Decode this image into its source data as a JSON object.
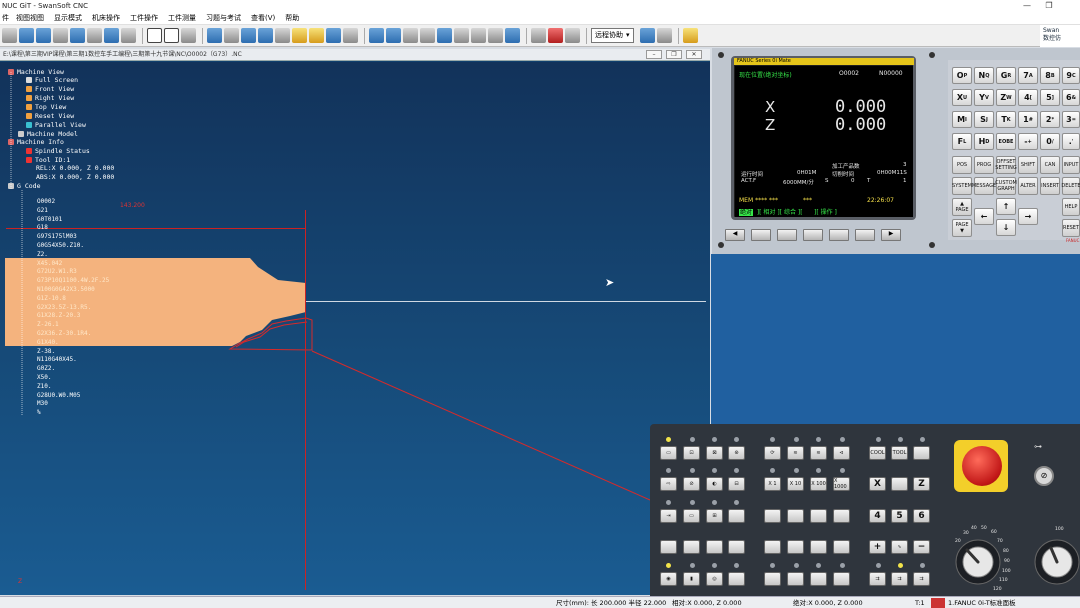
{
  "window": {
    "title": "NUC GiT - SwanSoft CNC",
    "minimize_glyph": "—",
    "restore_glyph": "❐"
  },
  "menu": [
    "视图视图",
    "显示模式",
    "机床操作",
    "工件操作",
    "工件测量",
    "习题与考试",
    "查看(V)",
    "帮助"
  ],
  "menu_prefix": "件",
  "toolbar": {
    "remote_label": "远程协助",
    "logo_line1": "Swan",
    "logo_line2": "数控仿"
  },
  "view": {
    "path": "E:\\课程\\第三期VIP课程\\第三期1数控车手工编程\\三期第十九节课\\NC\\O0002（G73）.NC",
    "coord_label": "143.200",
    "axis_label": "Z",
    "tree": {
      "machine_view": "Machine View",
      "full_screen": "Full Screen",
      "front_view": "Front View",
      "right_view": "Right View",
      "top_view": "Top View",
      "reset_view": "Reset View",
      "parallel_view": "Parallel View",
      "machine_model": "Machine Model",
      "machine_info": "Machine Info",
      "spindle_status": "Spindle Status",
      "tool_id": "Tool ID:1",
      "rel": "REL:X    0.000, Z    0.000",
      "abs": "ABS:X    0.000, Z    0.000",
      "gcode": "G Code"
    },
    "gcode_lines": [
      "O0002",
      "G21",
      "G0T0101",
      "G18",
      "G97S175lM03",
      "G0G54X50.Z10.",
      "Z2.",
      "X45.042",
      "G72U2.W1.R3",
      "G73P10Q1100.4W.2F.25",
      "N100G0G42X3.5000",
      "G1Z-10.8",
      "G2X23.5Z-13.R5.",
      "G1X28.Z-20.3",
      "Z-26.1",
      "G2X36.Z-30.1R4.",
      "G1X40.",
      "Z-38.",
      "N110G40X45.",
      "G0Z2.",
      "X50.",
      "Z10.",
      "G28U0.W0.M05",
      "M30",
      "%"
    ]
  },
  "cnc_screen": {
    "header": "FANUC Series 0i Mate",
    "position_title": "现在位置(绝对坐标)",
    "program_no": "O0002",
    "seq_no": "N00000",
    "x_label": "X",
    "x_value": "0.000",
    "z_label": "Z",
    "z_value": "0.000",
    "parts_label": "加工产品数",
    "parts_value": "3",
    "run_time_label": "运行时间",
    "run_time_value": "0H01M",
    "cycle_time_label": "切削时间",
    "cycle_time_value": "0H00M11S",
    "actf_label": "ACT.F",
    "actf_value": "6000MM/分",
    "s_label": "S",
    "s_value": "0",
    "t_label": "T",
    "t_value": "1",
    "mode": "MEM",
    "mode_stars": "****  ***",
    "mode_stars2": "***",
    "clock": "22:26:07",
    "softkeys": [
      "绝对",
      "相对",
      "综合",
      "",
      "操作"
    ]
  },
  "keypad": {
    "rows": [
      [
        "O",
        "N",
        "G",
        "7",
        "8",
        "9"
      ],
      [
        "X",
        "Y",
        "Z",
        "4",
        "5",
        "6"
      ],
      [
        "M",
        "S",
        "T",
        "1",
        "2",
        "3"
      ],
      [
        "F",
        "H",
        "EOB",
        "-",
        "0",
        "."
      ]
    ],
    "subs": [
      [
        "P",
        "Q",
        "R",
        "A",
        "B",
        "C"
      ],
      [
        "U",
        "V",
        "W",
        "[",
        "]",
        "&"
      ],
      [
        "I",
        "J",
        "K",
        "#",
        "*",
        "="
      ],
      [
        "L",
        "D",
        "E",
        "+",
        "/",
        "'"
      ]
    ],
    "fn_row1": [
      "POS",
      "PROG",
      "OFFSET SETTING",
      "SHIFT",
      "CAN",
      "INPUT"
    ],
    "fn_row2": [
      "SYSTEM",
      "MESSAGE",
      "CUSTOM GRAPH",
      "ALTER",
      "INSERT",
      "DELETE"
    ],
    "page_up": "PAGE",
    "page_down": "PAGE",
    "help": "HELP",
    "reset": "RESET",
    "brand": "FANUC"
  },
  "machine_panel": {
    "cool": "COOL",
    "tool": "TOOL",
    "x_btn": "X",
    "z_btn": "Z",
    "num4": "4",
    "num5": "5",
    "num6": "6",
    "plus": "+",
    "minus": "−",
    "step_x1": "X 1",
    "step_x10": "X 10",
    "step_x100": "X 100",
    "step_x1000": "X 1000",
    "dial_marks": "20 30 40 50 60 70 80 90 100 110 120",
    "dial_right": "100"
  },
  "status": {
    "size": "尺寸(mm): 长 200.000 半径 22.000",
    "rel": "相对:X    0.000, Z    0.000",
    "abs": "绝对:X    0.000, Z    0.000",
    "tool": "T:1",
    "machine": "1.FANUC 0i-T标准面板"
  },
  "colors": {
    "viewport_top": "#12325a",
    "viewport_bottom": "#1a5c92",
    "stock": "#f4b37e",
    "toolpath": "#d62a2a",
    "fanuc_yellow": "#e5c51a",
    "screen_green": "#37e84a",
    "screen_yellow": "#f5e04a"
  }
}
